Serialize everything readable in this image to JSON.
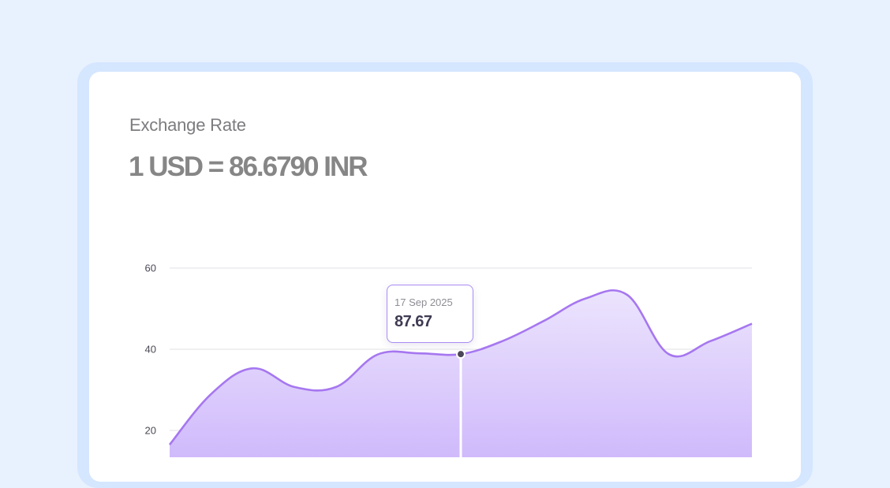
{
  "card": {
    "title": "Exchange Rate",
    "rate": "1 USD = 86.6790 INR"
  },
  "tooltip": {
    "date": "17 Sep 2025",
    "value": "87.67"
  },
  "colors": {
    "line": "#a677f0",
    "area_top": "#ece4fd",
    "area_bottom": "#cdb6fb",
    "grid": "#e2e2e6",
    "frame": "#d5e6ff",
    "background": "#e8f1fe"
  },
  "chart_data": {
    "type": "area",
    "title": "",
    "xlabel": "",
    "ylabel": "",
    "ylim": [
      0,
      60
    ],
    "yticks": [
      20,
      40,
      60
    ],
    "grid": true,
    "x": [
      0,
      1,
      2,
      3,
      4,
      5,
      6,
      7,
      8,
      9,
      10,
      11,
      12,
      13,
      14
    ],
    "values": [
      16.5,
      29,
      35.3,
      30.7,
      30.7,
      38.7,
      39,
      38.8,
      42,
      47,
      52.5,
      53.4,
      38.8,
      42,
      46.3
    ],
    "highlight": {
      "index": 7,
      "label": "17 Sep 2025",
      "value": "87.67"
    }
  }
}
